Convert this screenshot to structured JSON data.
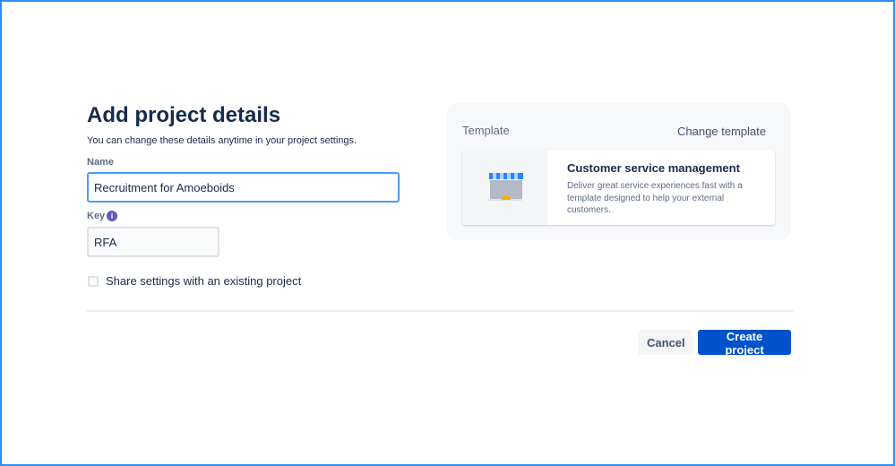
{
  "page": {
    "title": "Add project details",
    "subtitle": "You can change these details anytime in your project settings."
  },
  "form": {
    "name_label": "Name",
    "name_value": "Recruitment for Amoeboids",
    "key_label": "Key",
    "key_value": "RFA",
    "share_label": "Share settings with an existing project",
    "share_checked": false
  },
  "template": {
    "label": "Template",
    "change_label": "Change template",
    "card_title": "Customer service management",
    "card_desc": "Deliver great service experiences fast with a template designed to help your external customers."
  },
  "actions": {
    "cancel": "Cancel",
    "create": "Create project"
  },
  "colors": {
    "primary": "#0052cc",
    "focus": "#4c9aff",
    "info": "#6554c0"
  }
}
